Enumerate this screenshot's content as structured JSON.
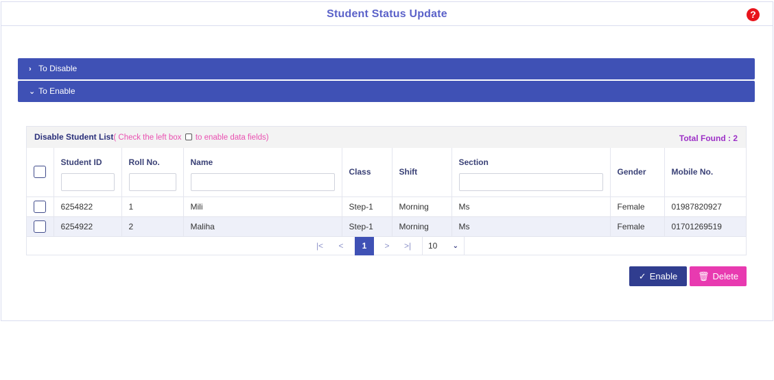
{
  "header": {
    "title": "Student Status Update",
    "help_icon": "?"
  },
  "accordion": [
    {
      "label": "To Disable",
      "chevron": "›",
      "expanded": false
    },
    {
      "label": "To Enable",
      "chevron": "⌄",
      "expanded": true
    }
  ],
  "table": {
    "caption_title": "Disable Student List",
    "caption_note_before": "( Check the left box ",
    "caption_note_after": " to enable data fields)",
    "total_found": "Total Found : 2",
    "columns": [
      "Student ID",
      "Roll No.",
      "Name",
      "Class",
      "Shift",
      "Section",
      "Gender",
      "Mobile No."
    ],
    "rows": [
      [
        "6254822",
        "1",
        "Mili",
        "Step-1",
        "Morning",
        "Ms",
        "Female",
        "01987820927"
      ],
      [
        "6254922",
        "2",
        "Maliha",
        "Step-1",
        "Morning",
        "Ms",
        "Female",
        "01701269519"
      ]
    ]
  },
  "pager": {
    "first": "|<",
    "prev": "<",
    "current": "1",
    "next": ">",
    "last": ">|",
    "rows_per_page": "10",
    "dropdown_icon": "⌄"
  },
  "actions": {
    "enable_label": "Enable",
    "delete_label": "Delete",
    "enable_icon": "✓",
    "delete_icon": "🗑"
  },
  "colors": {
    "accent": "#3f51b5",
    "enable": "#303d8f",
    "delete": "#e83ab0",
    "title": "#5b62c9",
    "help": "#e8141c"
  }
}
